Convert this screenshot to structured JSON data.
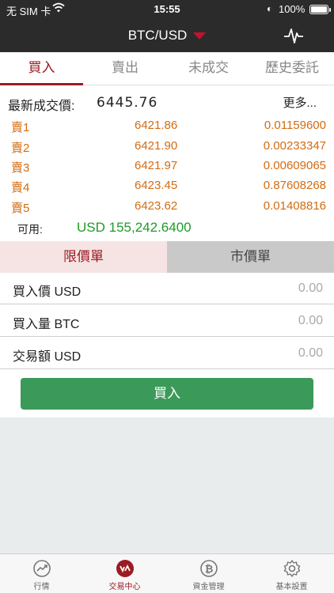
{
  "status": {
    "carrier": "无 SIM 卡",
    "time": "15:55",
    "battery": "100%"
  },
  "header": {
    "pair": "BTC/USD"
  },
  "tabs": [
    {
      "label": "買入",
      "active": true
    },
    {
      "label": "賣出",
      "active": false
    },
    {
      "label": "未成交",
      "active": false
    },
    {
      "label": "歷史委託",
      "active": false
    }
  ],
  "book": {
    "last_label": "最新成交價:",
    "last_price": "6445.76",
    "more": "更多...",
    "asks": [
      {
        "name": "賣1",
        "price": "6421.86",
        "qty": "0.01159600"
      },
      {
        "name": "賣2",
        "price": "6421.90",
        "qty": "0.00233347"
      },
      {
        "name": "賣3",
        "price": "6421.97",
        "qty": "0.00609065"
      },
      {
        "name": "賣4",
        "price": "6423.45",
        "qty": "0.87608268"
      },
      {
        "name": "賣5",
        "price": "6423.62",
        "qty": "0.01408816"
      }
    ],
    "available_label": "可用:",
    "available_value": "USD 155,242.6400"
  },
  "order_type": {
    "limit": "限價單",
    "market": "市價單"
  },
  "form": {
    "price_label": "買入價 USD",
    "price_placeholder": "0.00",
    "amount_label": "買入量 BTC",
    "amount_placeholder": "0.00",
    "total_label": "交易額 USD",
    "total_placeholder": "0.00",
    "submit": "買入"
  },
  "bottom_nav": [
    {
      "label": "行情",
      "icon": "trend-icon"
    },
    {
      "label": "交易中心",
      "icon": "trade-center-icon"
    },
    {
      "label": "資金管理",
      "icon": "bitcoin-icon"
    },
    {
      "label": "基本設置",
      "icon": "gear-icon"
    }
  ],
  "colors": {
    "accent": "#9b1b22",
    "ask": "#d36b10",
    "available": "#1e9b27",
    "buy_button": "#3b9a5a"
  }
}
